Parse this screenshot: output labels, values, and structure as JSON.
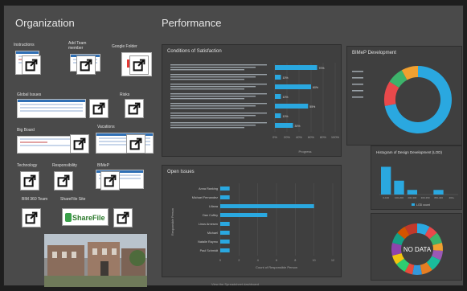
{
  "organization": {
    "title": "Organization",
    "tiles": [
      {
        "label": "Instructions"
      },
      {
        "label": "Add Team member"
      },
      {
        "label": "Google Folder"
      },
      {
        "label": "Global Issues"
      },
      {
        "label": "Risks"
      },
      {
        "label": "Big Board"
      },
      {
        "label": "Vacations"
      },
      {
        "label": "Technology"
      },
      {
        "label": "Responsibility"
      },
      {
        "label": "BIMeP"
      },
      {
        "label": "BIM 360 Team"
      },
      {
        "label": "ShareFile Site"
      }
    ],
    "sharefile_logo": "ShareFile"
  },
  "performance": {
    "title": "Performance",
    "conditions": {
      "title": "Conditions of Satisfaction",
      "chart_data": {
        "type": "bar",
        "orientation": "horizontal",
        "values": [
          70,
          10,
          60,
          10,
          55,
          10,
          30
        ],
        "value_labels": [
          "70%",
          "10%",
          "60%",
          "10%",
          "55%",
          "10%",
          "30%"
        ],
        "xlim": [
          0,
          100
        ],
        "xticks": [
          "0%",
          "20%",
          "40%",
          "60%",
          "80%",
          "100%"
        ],
        "xlabel": "Progress",
        "color": "#2aa8e0"
      }
    },
    "bimep": {
      "title": "BIMeP Development",
      "chart_data": {
        "type": "pie",
        "style": "donut",
        "values": [
          72,
          12,
          8,
          8
        ],
        "colors": [
          "#2aa8e0",
          "#e8494b",
          "#3db36b",
          "#f0a030"
        ]
      }
    },
    "open_issues": {
      "title": "Open Issues",
      "chart_data": {
        "type": "bar",
        "orientation": "horizontal",
        "categories": [
          "Anna Ranking",
          "Michael Fernandez",
          "Liliana",
          "Dan Cuffey",
          "Linus Arnesen",
          "Michael",
          "Natalie Raymo",
          "Paul Schmidt"
        ],
        "values": [
          1,
          1,
          10,
          5,
          1,
          1,
          1,
          1
        ],
        "xlim": [
          0,
          12
        ],
        "xlabel": "Count of Responsible Person",
        "ylabel": "Responsible Person",
        "color": "#2aa8e0"
      }
    },
    "histogram": {
      "title": "Histogram of Design Development (LOD)",
      "chart_data": {
        "type": "bar",
        "categories": [
          "0-100",
          "100-200",
          "200-300",
          "300-350",
          "350-400",
          "400+"
        ],
        "values": [
          6,
          3,
          1,
          0,
          1,
          0
        ],
        "ylim": [
          0,
          8
        ],
        "legend": [
          "LOD count"
        ],
        "color": "#2aa8e0"
      }
    },
    "nodata_donut": {
      "title": "",
      "label": "NO DATA",
      "chart_data": {
        "type": "pie",
        "style": "donut",
        "values": [
          8,
          6,
          7,
          5,
          6,
          8,
          7,
          6,
          5,
          7,
          6,
          8,
          7,
          6,
          8
        ],
        "colors": [
          "#2aa8e0",
          "#e8494b",
          "#3db36b",
          "#f0a030",
          "#9b59b6",
          "#1abc9c",
          "#e67e22",
          "#3498db",
          "#e74c3c",
          "#2ecc71",
          "#f1c40f",
          "#8e44ad",
          "#16a085",
          "#d35400",
          "#c0392b"
        ]
      }
    }
  },
  "footer": "View the Spreadsheet dashboard"
}
